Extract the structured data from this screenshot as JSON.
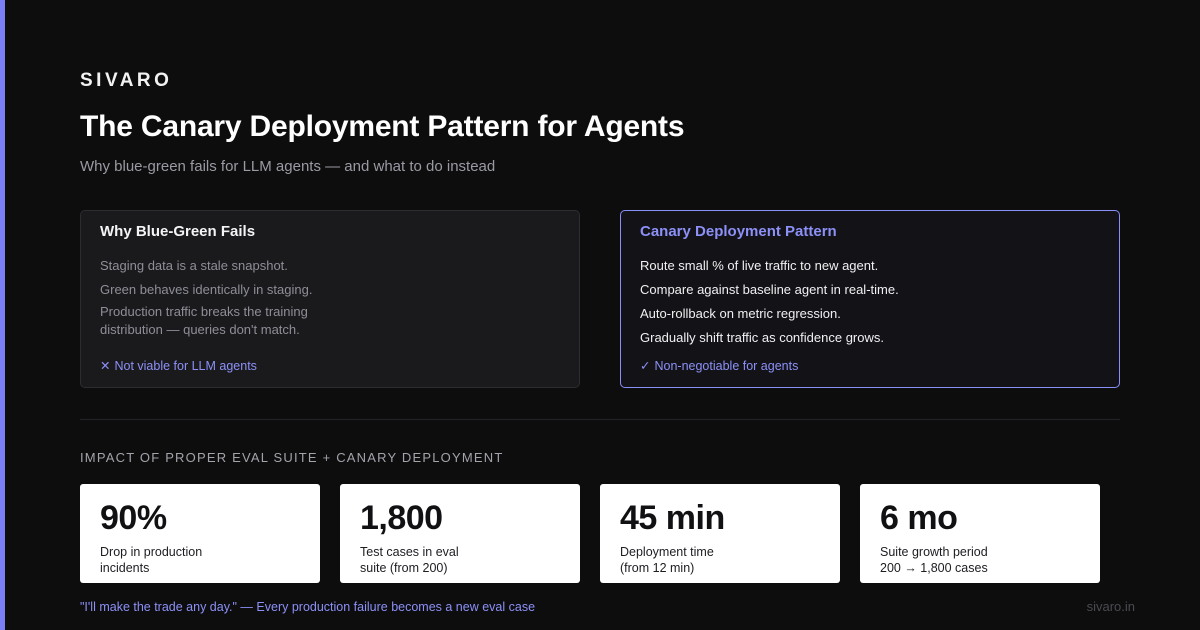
{
  "brand": "SIVARO",
  "title": "The Canary Deployment Pattern for Agents",
  "subtitle": "Why blue-green fails for LLM agents — and what to do instead",
  "colors": {
    "accent": "#7b7ff5",
    "background": "#0d0d0e",
    "card_surface": "#1a1a1d",
    "stat_surface": "#ffffff"
  },
  "left_card": {
    "title": "Why Blue-Green Fails",
    "items": [
      "Staging data is a stale snapshot.",
      "Green behaves identically in staging.",
      "Production traffic breaks the training",
      "distribution — queries don't match."
    ],
    "note_icon": "x-icon",
    "note_glyph": "✕",
    "note": "Not viable for LLM agents"
  },
  "right_card": {
    "title": "Canary Deployment Pattern",
    "items": [
      "Route small % of live traffic to new agent.",
      "Compare against baseline agent in real-time.",
      "Auto-rollback on metric regression.",
      "Gradually shift traffic as confidence grows."
    ],
    "note_icon": "check-icon",
    "note_glyph": "✓",
    "note": "Non-negotiable for agents"
  },
  "impact": {
    "heading": "IMPACT OF PROPER EVAL SUITE + CANARY DEPLOYMENT",
    "stats": [
      {
        "value": "90%",
        "label_line1": "Drop in production",
        "label_line2": "incidents"
      },
      {
        "value": "1,800",
        "label_line1": "Test cases in eval",
        "label_line2": "suite (from 200)"
      },
      {
        "value": "45 min",
        "label_line1": "Deployment time",
        "label_line2": "(from 12 min)"
      },
      {
        "value": "6 mo",
        "label_line1": "Suite growth period",
        "label_line2": "200 → 1,800 cases"
      }
    ]
  },
  "quote": {
    "text": "\"I'll make the trade any day.\"",
    "rest": " — Every production failure becomes a new eval case"
  },
  "footer_url": "sivaro.in"
}
